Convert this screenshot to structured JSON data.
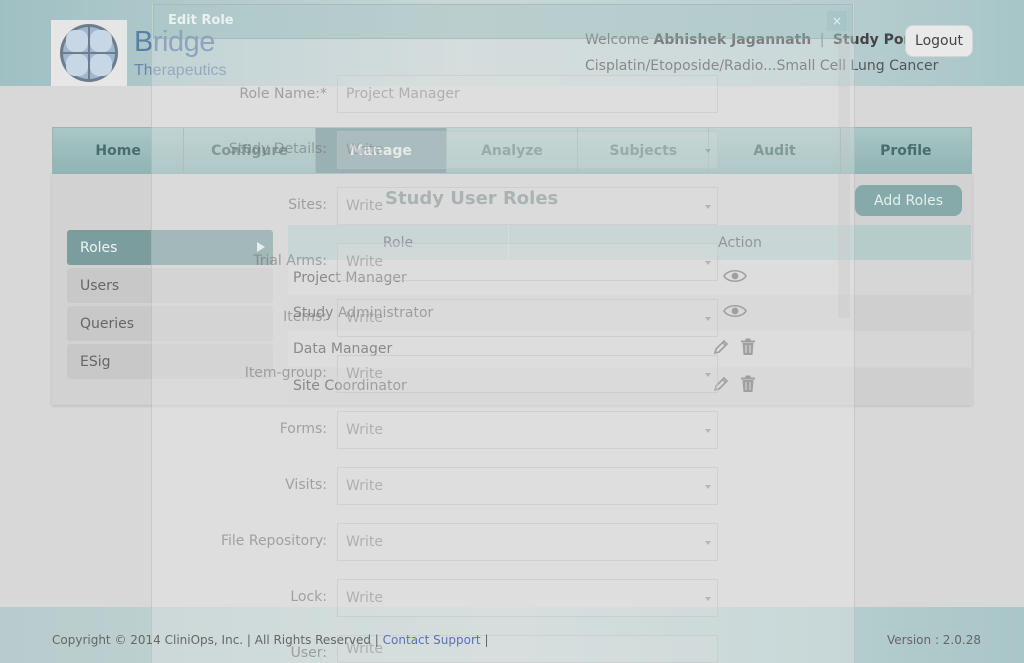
{
  "brand": {
    "name": "Bridge",
    "subtitle": "Therapeutics"
  },
  "header": {
    "welcome_prefix": "Welcome",
    "user_name": "Abhishek Jagannath",
    "separator": "|",
    "portal": "Study Portal",
    "study": "Cisplatin/Etoposide/Radio...Small Cell Lung Cancer",
    "logout_label": "Logout"
  },
  "nav": {
    "tabs": [
      {
        "label": "Home"
      },
      {
        "label": "Configure"
      },
      {
        "label": "Manage"
      },
      {
        "label": "Analyze"
      },
      {
        "label": "Subjects"
      },
      {
        "label": "Audit"
      },
      {
        "label": "Profile"
      }
    ],
    "active": "Manage"
  },
  "panel": {
    "title": "Study User Roles",
    "add_button": "Add Roles"
  },
  "sidebar": {
    "items": [
      {
        "label": "Roles"
      },
      {
        "label": "Users"
      },
      {
        "label": "Queries"
      },
      {
        "label": "ESig"
      }
    ],
    "active": "Roles"
  },
  "table": {
    "headers": {
      "role": "Role",
      "action": "Action"
    },
    "rows": [
      {
        "role": "Project Manager",
        "actions": [
          "view"
        ]
      },
      {
        "role": "Study Administrator",
        "actions": [
          "view"
        ]
      },
      {
        "role": "Data Manager",
        "actions": [
          "edit",
          "delete"
        ]
      },
      {
        "role": "Site Coordinator",
        "actions": [
          "edit",
          "delete"
        ]
      }
    ]
  },
  "modal": {
    "title": "Edit Role",
    "close": "×",
    "fields": [
      {
        "label": "Role Name:*",
        "value": "Project Manager"
      },
      {
        "label": "Study Details:",
        "value": "Write"
      },
      {
        "label": "Sites:",
        "value": "Write"
      },
      {
        "label": "Trial Arms:",
        "value": "Write"
      },
      {
        "label": "Items:",
        "value": "Write"
      },
      {
        "label": "Item-group:",
        "value": "Write"
      },
      {
        "label": "Forms:",
        "value": "Write"
      },
      {
        "label": "Visits:",
        "value": "Write"
      },
      {
        "label": "File Repository:",
        "value": "Write"
      },
      {
        "label": "Lock:",
        "value": "Write"
      },
      {
        "label": "User:",
        "value": "Write"
      }
    ]
  },
  "footer": {
    "copyright": "Copyright © 2014 CliniOps, Inc. | All Rights Reserved |",
    "contact": "Contact Support",
    "trail": "|",
    "version": "Version : 2.0.28"
  },
  "colors": {
    "accent": "#7b9d9e",
    "nav_bg": "#a9c6c5",
    "brand_blue": "#5a7fa6"
  }
}
